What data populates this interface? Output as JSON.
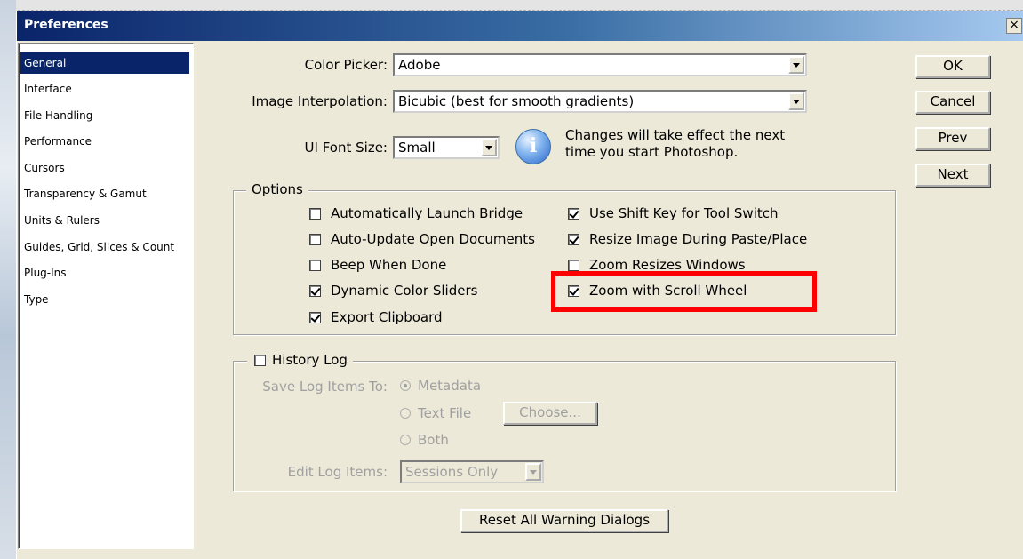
{
  "window": {
    "title": "Preferences",
    "close_glyph": "×"
  },
  "sidebar": {
    "items": [
      {
        "label": "General",
        "selected": true
      },
      {
        "label": "Interface"
      },
      {
        "label": "File Handling"
      },
      {
        "label": "Performance"
      },
      {
        "label": "Cursors"
      },
      {
        "label": "Transparency & Gamut"
      },
      {
        "label": "Units & Rulers"
      },
      {
        "label": "Guides, Grid, Slices & Count"
      },
      {
        "label": "Plug-Ins"
      },
      {
        "label": "Type"
      }
    ]
  },
  "general": {
    "color_picker_label": "Color Picker:",
    "color_picker_value": "Adobe",
    "interpolation_label": "Image Interpolation:",
    "interpolation_value": "Bicubic (best for smooth gradients)",
    "ui_font_label": "UI Font Size:",
    "ui_font_value": "Small",
    "info_line1": "Changes will take effect the next",
    "info_line2": "time you start Photoshop.",
    "info_icon_glyph": "i"
  },
  "buttons": {
    "ok": "OK",
    "cancel": "Cancel",
    "prev": "Prev",
    "next": "Next",
    "reset": "Reset All Warning Dialogs",
    "choose": "Choose..."
  },
  "options": {
    "legend": "Options",
    "left": [
      {
        "label": "Automatically Launch Bridge",
        "checked": false
      },
      {
        "label": "Auto-Update Open Documents",
        "checked": false
      },
      {
        "label": "Beep When Done",
        "checked": false
      },
      {
        "label": "Dynamic Color Sliders",
        "checked": true
      },
      {
        "label": "Export Clipboard",
        "checked": true
      }
    ],
    "right": [
      {
        "label": "Use Shift Key for Tool Switch",
        "checked": true
      },
      {
        "label": "Resize Image During Paste/Place",
        "checked": true
      },
      {
        "label": "Zoom Resizes Windows",
        "checked": false
      },
      {
        "label": "Zoom with Scroll Wheel",
        "checked": true
      }
    ]
  },
  "history": {
    "legend": "History Log",
    "enabled": false,
    "save_to_label": "Save Log Items To:",
    "radio_metadata": "Metadata",
    "radio_textfile": "Text File",
    "radio_both": "Both",
    "selected": "Metadata",
    "edit_label": "Edit Log Items:",
    "edit_value": "Sessions Only"
  },
  "colors": {
    "title_start": "#0a246a",
    "selection": "#0a246a",
    "highlight": "#ff0000",
    "dialog_bg": "#ece9d8"
  }
}
